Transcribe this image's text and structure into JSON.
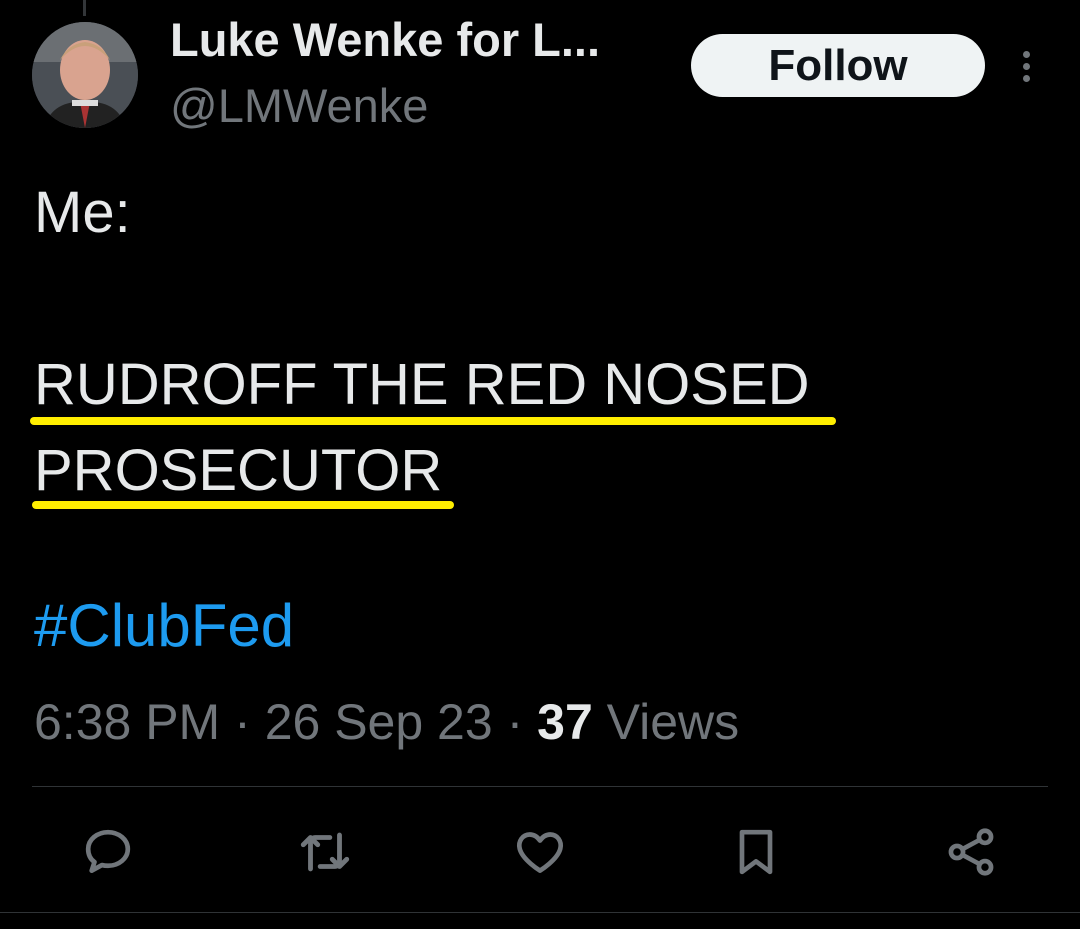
{
  "author": {
    "display_name": "Luke Wenke for L...",
    "handle": "@LMWenke"
  },
  "follow_label": "Follow",
  "tweet": {
    "line1": "Me:",
    "line2": "RUDROFF THE RED NOSED",
    "line3": "PROSECUTOR",
    "hashtag": "#ClubFed"
  },
  "meta": {
    "time": "6:38 PM",
    "separator": "·",
    "date": "26 Sep 23",
    "views_count": "37",
    "views_label": "Views"
  },
  "actions": [
    {
      "icon": "reply-icon"
    },
    {
      "icon": "retweet-icon"
    },
    {
      "icon": "like-icon"
    },
    {
      "icon": "bookmark-icon"
    },
    {
      "icon": "share-icon"
    }
  ],
  "colors": {
    "background": "#000000",
    "text": "#e7e9ea",
    "secondary_text": "#71767b",
    "hashtag": "#1d9bf0",
    "highlight_underline": "#ffee00",
    "follow_button_bg": "#eff3f4"
  }
}
